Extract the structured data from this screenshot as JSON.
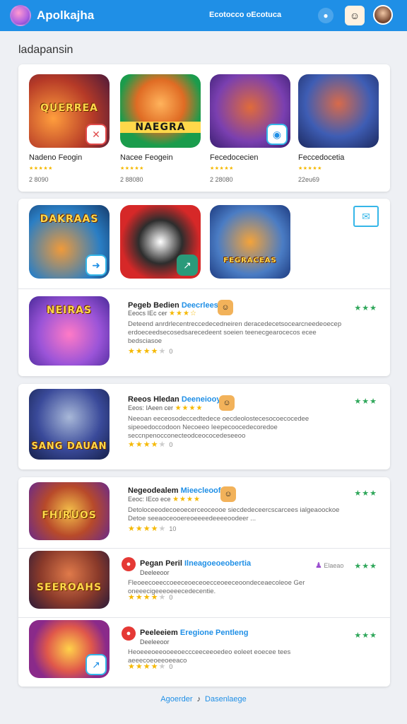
{
  "header": {
    "app_title": "Apolkajha",
    "top_link": "Ecotocco oEcotuca",
    "chat_icon": "chat-bubble-icon",
    "app_icon": "game-tile-icon"
  },
  "section_title": "ladapansin",
  "featured": [
    {
      "name": "Nadeno Feogin",
      "downloads": "2 8090",
      "thumb_text": "QUERREA",
      "badge": "✕"
    },
    {
      "name": "Nacee Feogein",
      "downloads": "2 88080",
      "thumb_text": "NAEGRA",
      "badge": ""
    },
    {
      "name": "Fecedocecien",
      "downloads": "2 28080",
      "thumb_text": "",
      "badge": "◉"
    },
    {
      "name": "Feccedocetia",
      "downloads": "22eu69",
      "thumb_text": "",
      "badge": ""
    }
  ],
  "grid_row": {
    "thumbs": [
      {
        "thumb_text": "DAKRAAS",
        "badge": "➜"
      },
      {
        "thumb_text": "",
        "badge": "↗"
      },
      {
        "thumb_text": "FEGRACEAS",
        "badge": "☻"
      }
    ]
  },
  "list_items": [
    {
      "title": "Pegeb Bedien",
      "accent": "Deecrleesoy",
      "sub": "Eeocs IEc cer",
      "desc": "Deteend anrdrlecentreccedecedneiren deracedecetsocearcneedeoecep erdoeceedsecosedsarecedeent soeien teenecgearocecos ecee bedsciasoe",
      "rating": "0",
      "thumb_text": "NEIRAS",
      "badge": "✎"
    },
    {
      "title": "Reeos Hledan",
      "accent": "Deeneiooy",
      "sub": "Eeos: IAeen cer",
      "desc": "Neeoan eeceosodeccedtedece oecdeolostecesocoecocedee sipeoedoccodoon Necoeeo Ieepecoocedecoredoe seccnpenocconecteodceococedeseeoo",
      "rating": "0",
      "thumb_text": "SANG DAUAN",
      "badge": ""
    },
    {
      "title": "Negeodealem",
      "accent": "Mieecleoof",
      "sub": "Eeoc: IEco ece",
      "desc": "Detoloceeodecoeoecerceoceooe siecdedeceercscarcees ialgeaoockoe Detoe seeaoceooereoeeeedeeeeoodeer ...",
      "rating": "10",
      "thumb_text": "FHIRUOS",
      "badge": ""
    },
    {
      "title": "Pegan Peril",
      "accent": "Ilneagoeoeobertia",
      "sub": "Deeleeoor",
      "tag": "Elaeao",
      "desc": "Fleoeecoeeccoeeceoeceoecceoeeceoondeceaecoleoe Ger oneeecigeeeoeeecedecentie.",
      "rating": "0",
      "thumb_text": "SEEROAHS",
      "badge": ""
    },
    {
      "title": "Peeleeiem",
      "accent": "Eregione Pentleng",
      "sub": "Deeleeoor",
      "desc": "Heoeeeoeeooeeoeccceeceeoedeo eoleet eoecee tees aeeecoeoeeoeeaco",
      "rating": "0",
      "thumb_text": "",
      "badge": "↗"
    }
  ],
  "footer": {
    "left": "Agoerder",
    "right": "Dasenlaege"
  },
  "colors": {
    "brand": "#1f8fe6",
    "star": "#f5b800",
    "green_star": "#2fa75a"
  }
}
